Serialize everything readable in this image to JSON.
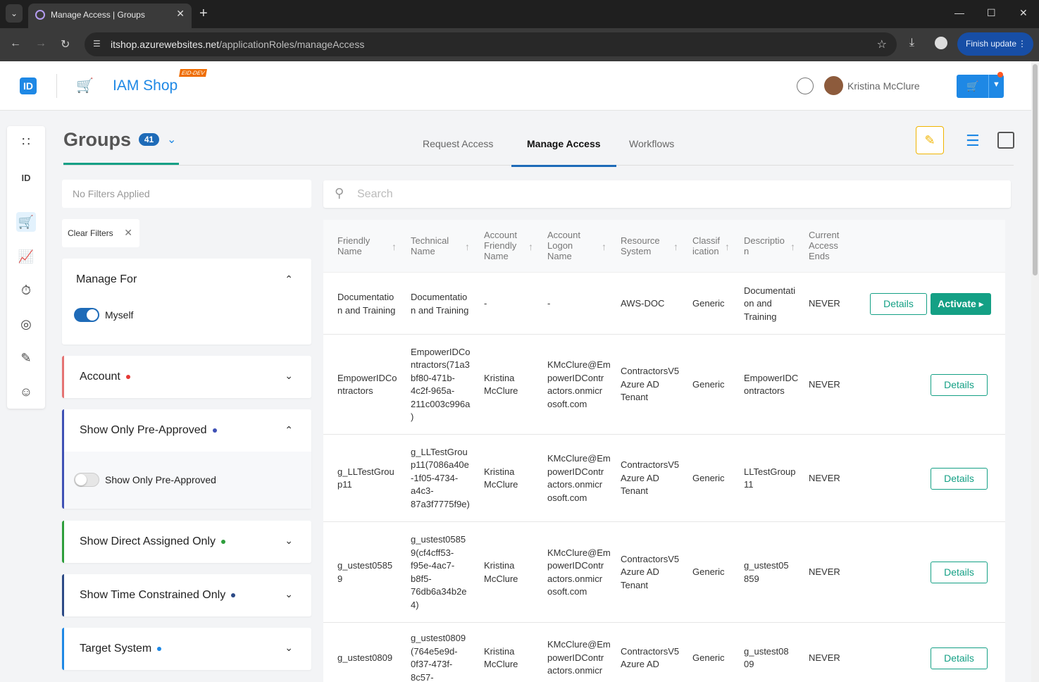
{
  "browser": {
    "tab_title": "Manage Access | Groups",
    "url_host": "itshop.azurewebsites.net",
    "url_path": "/applicationRoles/manageAccess",
    "finish_update": "Finish update"
  },
  "header": {
    "logo_text": "ID",
    "shop_name": "IAM Shop",
    "env_badge": "EID-DEV",
    "user_name": "Kristina McClure"
  },
  "page": {
    "title": "Groups",
    "count": "41",
    "tabs": [
      "Request Access",
      "Manage Access",
      "Workflows"
    ],
    "active_tab": "Manage Access"
  },
  "filters": {
    "no_filters": "No Filters Applied",
    "clear_filters": "Clear Filters",
    "manage_for": {
      "title": "Manage For",
      "toggle_label": "Myself",
      "on": true
    },
    "account": {
      "title": "Account",
      "dot_color": "#e53935"
    },
    "pre_approved": {
      "title": "Show Only Pre-Approved",
      "toggle_label": "Show Only Pre-Approved",
      "on": false,
      "dot_color": "#3f51b5",
      "accent": "#3f51b5"
    },
    "direct_assigned": {
      "title": "Show Direct Assigned Only",
      "dot_color": "#2e9e3c",
      "accent": "#2e9e3c"
    },
    "time_constrained": {
      "title": "Show Time Constrained Only",
      "dot_color": "#2c4a86",
      "accent": "#2c4a86"
    },
    "target_system": {
      "title": "Target System",
      "dot_color": "#1e88e5",
      "accent": "#1e88e5"
    }
  },
  "search": {
    "placeholder": "Search"
  },
  "table": {
    "columns": [
      "Friendly\nName",
      "Technical\nName",
      "Account\nFriendly\nName",
      "Account\nLogon\nName",
      "Resource\nSystem",
      "Classif\nication",
      "Descriptio\nn",
      "Current\nAccess\nEnds"
    ],
    "details_label": "Details",
    "activate_label": "Activate",
    "rows": [
      {
        "friendly": "Documentatio\nn and Training",
        "technical": "Documentatio\nn and Training",
        "acct_friendly": "-",
        "acct_logon": "-",
        "resource": "AWS-DOC",
        "classification": "Generic",
        "description": "Documentati\non and\nTraining",
        "ends": "NEVER",
        "activate": true
      },
      {
        "friendly": "EmpowerIDCo\nntractors",
        "technical": "EmpowerIDCo\nntractors(71a3\nbf80-471b-\n4c2f-965a-\n211c003c996a\n)",
        "acct_friendly": "Kristina\nMcClure",
        "acct_logon": "KMcClure@Em\npowerIDContr\nactors.onmicr\nosoft.com",
        "resource": "ContractorsV5\nAzure AD\nTenant",
        "classification": "Generic",
        "description": "EmpowerIDC\nontractors",
        "ends": "NEVER",
        "activate": false
      },
      {
        "friendly": "g_LLTestGrou\np11",
        "technical": "g_LLTestGrou\np11(7086a40e\n-1f05-4734-\na4c3-\n87a3f7775f9e)",
        "acct_friendly": "Kristina\nMcClure",
        "acct_logon": "KMcClure@Em\npowerIDContr\nactors.onmicr\nosoft.com",
        "resource": "ContractorsV5\nAzure AD\nTenant",
        "classification": "Generic",
        "description": "LLTestGroup\n11",
        "ends": "NEVER",
        "activate": false
      },
      {
        "friendly": "g_ustest0585\n9",
        "technical": "g_ustest0585\n9(cf4cff53-\nf95e-4ac7-\nb8f5-\n76db6a34b2e\n4)",
        "acct_friendly": "Kristina\nMcClure",
        "acct_logon": "KMcClure@Em\npowerIDContr\nactors.onmicr\nosoft.com",
        "resource": "ContractorsV5\nAzure AD\nTenant",
        "classification": "Generic",
        "description": "g_ustest05\n859",
        "ends": "NEVER",
        "activate": false
      },
      {
        "friendly": "g_ustest0809",
        "technical": "g_ustest0809\n(764e5e9d-\n0f37-473f-\n8c57-",
        "acct_friendly": "Kristina\nMcClure",
        "acct_logon": "KMcClure@Em\npowerIDContr\nactors.onmicr",
        "resource": "ContractorsV5\nAzure AD",
        "classification": "Generic",
        "description": "g_ustest08\n09",
        "ends": "NEVER",
        "activate": false
      }
    ]
  }
}
